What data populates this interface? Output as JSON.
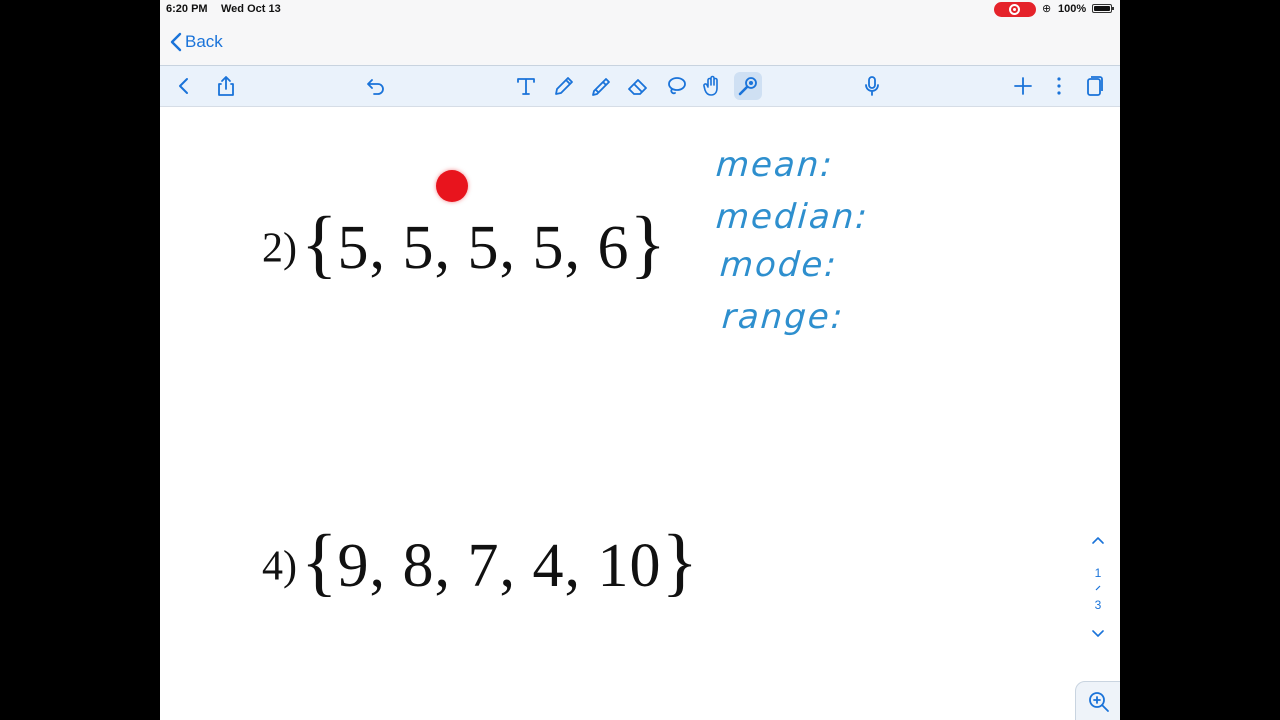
{
  "status": {
    "time": "6:20 PM",
    "date": "Wed Oct 13",
    "battery": "100%"
  },
  "nav": {
    "back_label": "Back"
  },
  "toolbar": {
    "icons": [
      "chevron-left-icon",
      "share-icon",
      "undo-icon",
      "text-tool-icon",
      "pen-icon",
      "highlighter-icon",
      "eraser-icon",
      "lasso-icon",
      "hand-tool-icon",
      "laser-pointer-icon",
      "microphone-icon",
      "plus-icon",
      "more-icon",
      "pages-icon"
    ]
  },
  "problems": [
    {
      "number": "2)",
      "set": "5, 5, 5, 5, 6"
    },
    {
      "number": "4)",
      "set": "9, 8, 7, 4, 10"
    }
  ],
  "handwriting": [
    "mean:",
    "median:",
    "mode:",
    "range:"
  ],
  "pagination": {
    "current": "1",
    "total": "3"
  },
  "colors": {
    "accent": "#1a73d9",
    "ink": "#2e8fce",
    "laser": "#e8141d",
    "recording": "#e5232b"
  }
}
